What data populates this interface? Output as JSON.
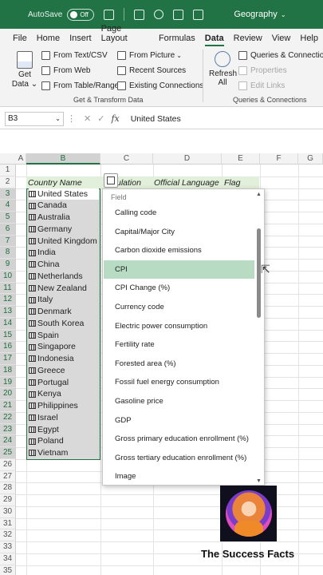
{
  "titlebar": {
    "autosave_label": "AutoSave",
    "toggle_state": "Off",
    "filename": "Geography"
  },
  "menu": {
    "tabs": [
      "File",
      "Home",
      "Insert",
      "Page Layout",
      "Formulas",
      "Data",
      "Review",
      "View",
      "Help"
    ],
    "active_tab": "Data"
  },
  "ribbon": {
    "get_data": "Get Data",
    "from_text_csv": "From Text/CSV",
    "from_web": "From Web",
    "from_table_range": "From Table/Range",
    "from_picture": "From Picture",
    "recent_sources": "Recent Sources",
    "existing_connections": "Existing Connections",
    "group_get_transform": "Get & Transform Data",
    "refresh_all": "Refresh All",
    "queries_connections": "Queries & Connections",
    "properties": "Properties",
    "edit_links": "Edit Links",
    "group_queries": "Queries & Connections"
  },
  "formula_bar": {
    "name_box": "B3",
    "formula": "United States"
  },
  "columns": [
    "A",
    "B",
    "C",
    "D",
    "E",
    "F",
    "G"
  ],
  "rows": [
    "1",
    "2",
    "3",
    "4",
    "5",
    "6",
    "7",
    "8",
    "9",
    "10",
    "11",
    "12",
    "13",
    "14",
    "15",
    "16",
    "17",
    "18",
    "19",
    "20",
    "21",
    "22",
    "23",
    "24",
    "25",
    "26",
    "27",
    "28",
    "29",
    "30",
    "31",
    "32",
    "33",
    "34",
    "35"
  ],
  "headers": {
    "country_name": "Country Name",
    "population": "ulation",
    "official_language": "Official Language",
    "flag": "Flag"
  },
  "countries": [
    "United States",
    "Canada",
    "Australia",
    "Germany",
    "United Kingdom",
    "India",
    "China",
    "Netherlands",
    "New Zealand",
    "Italy",
    "Denmark",
    "South Korea",
    "Spain",
    "Singapore",
    "Indonesia",
    "Greece",
    "Portugal",
    "Kenya",
    "Philippines",
    "Israel",
    "Egypt",
    "Poland",
    "Vietnam"
  ],
  "dropdown": {
    "label": "Field",
    "items": [
      "Calling code",
      "Capital/Major City",
      "Carbon dioxide emissions",
      "CPI",
      "CPI Change (%)",
      "Currency code",
      "Electric power consumption",
      "Fertility rate",
      "Forested area (%)",
      "Fossil fuel energy consumption",
      "Gasoline price",
      "GDP",
      "Gross primary education enrollment (%)",
      "Gross tertiary education enrollment (%)",
      "Image"
    ],
    "selected": "CPI"
  },
  "brand": {
    "name": "The Success Facts"
  },
  "colors": {
    "accent": "#217346",
    "selected_item": "#b7dcc3",
    "header_band": "#e2efda"
  }
}
